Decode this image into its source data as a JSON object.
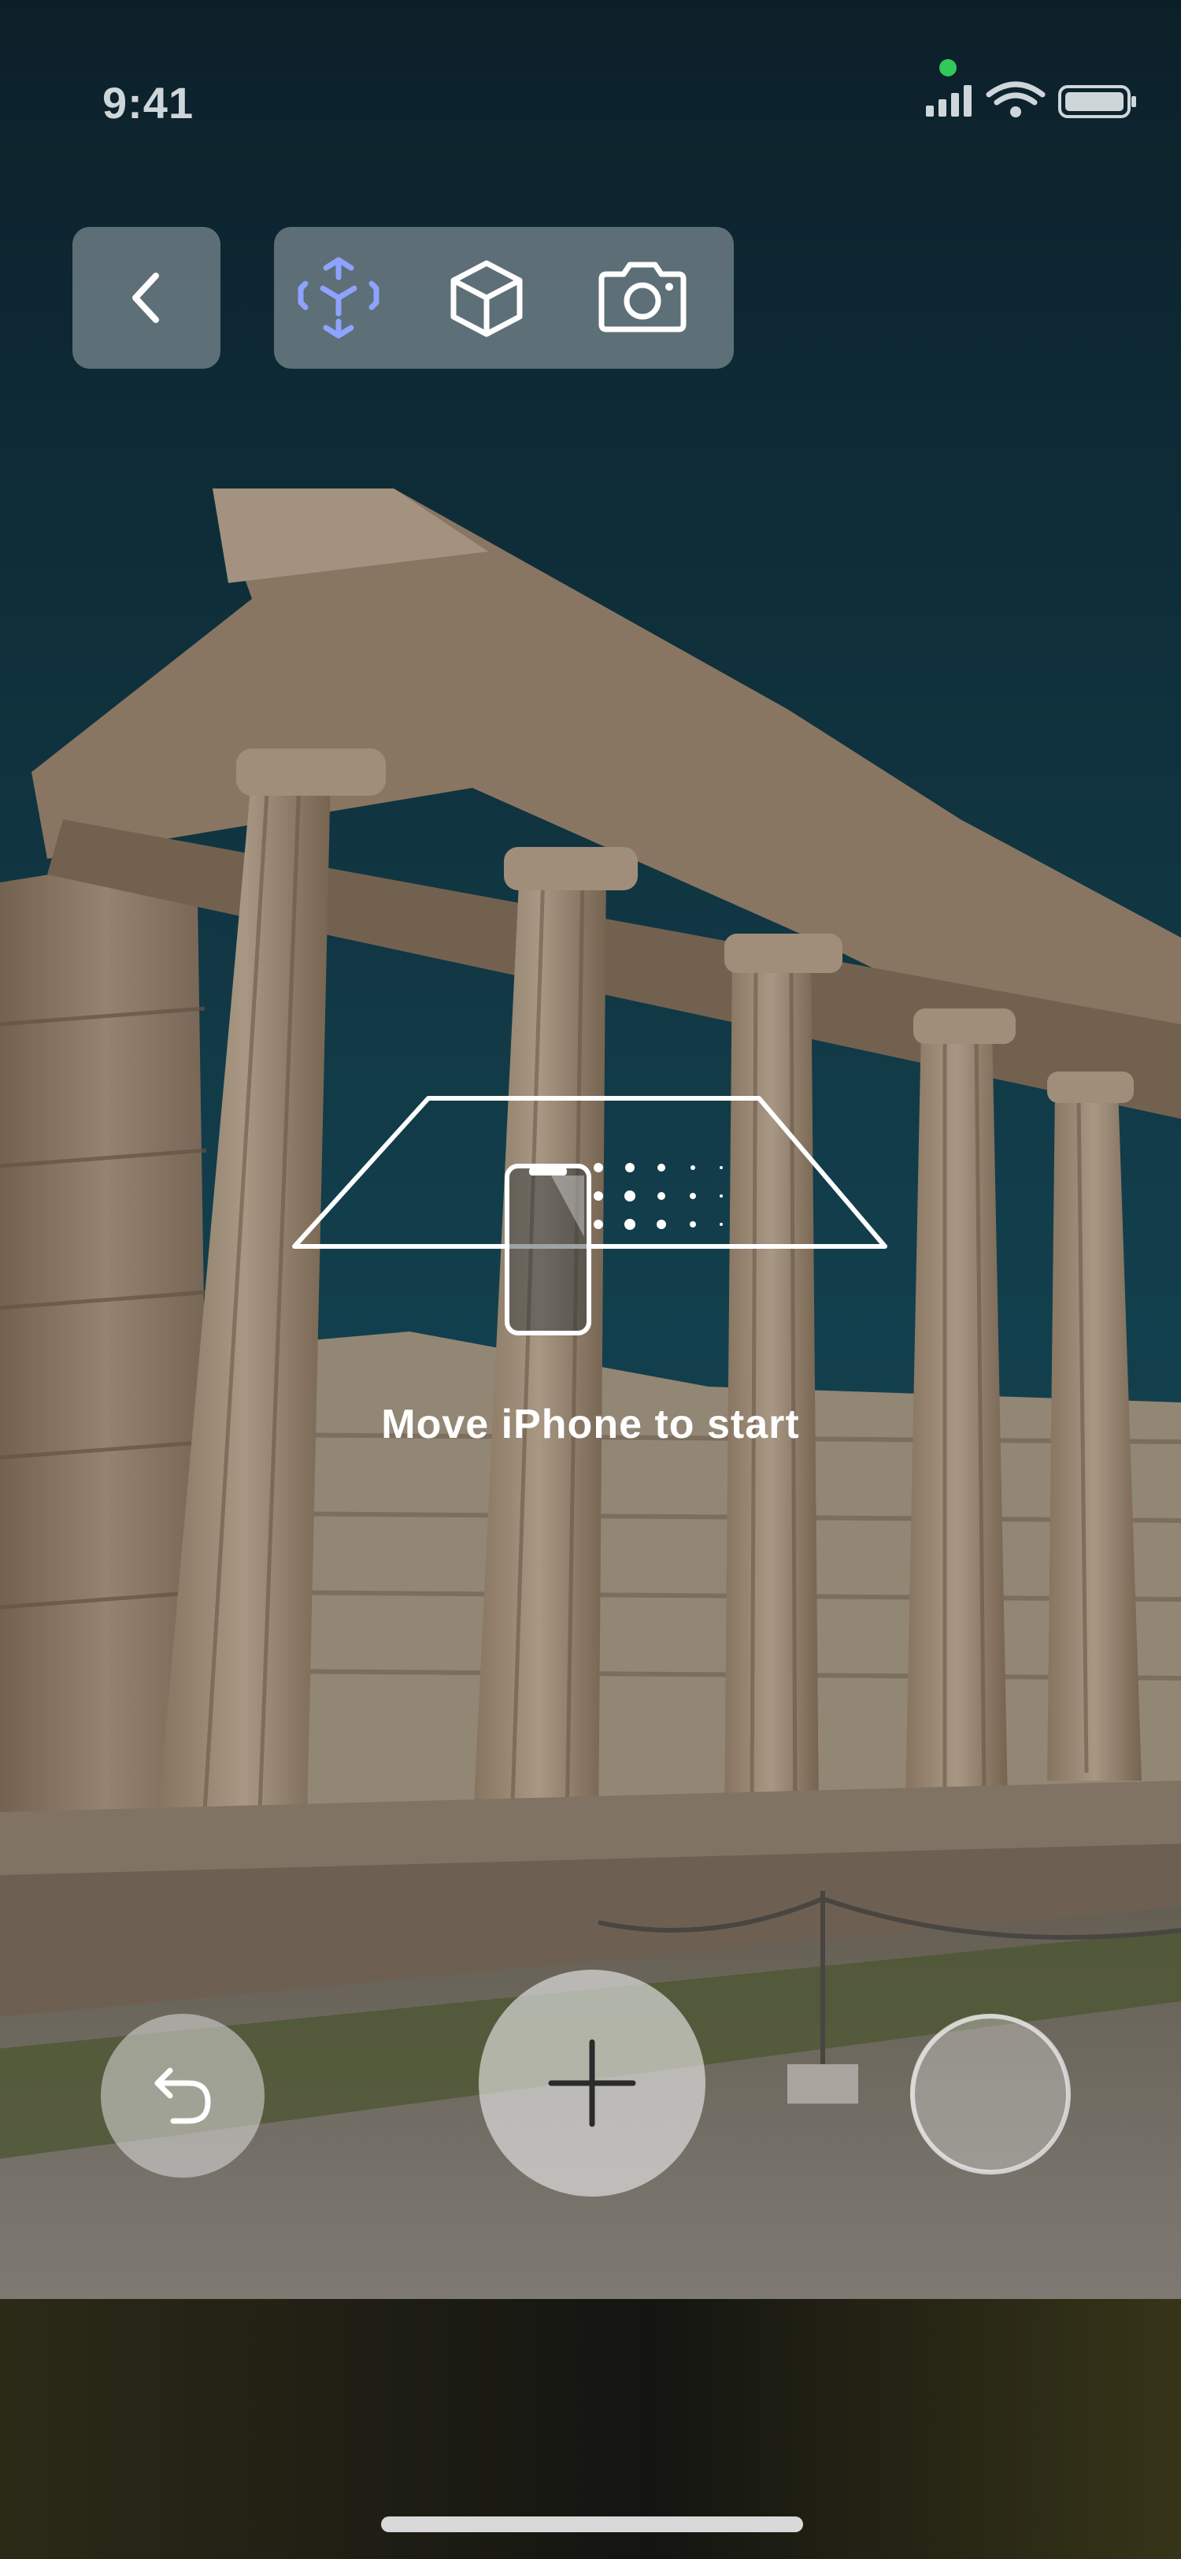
{
  "status_bar": {
    "time": "9:41"
  },
  "toolbar": {
    "back_icon": "chevron-left-icon",
    "modes": [
      {
        "name": "ar-measure",
        "icon": "ar-cube-scan-icon",
        "active": true
      },
      {
        "name": "3d-object",
        "icon": "cube-icon",
        "active": false
      },
      {
        "name": "photo",
        "icon": "camera-icon",
        "active": false
      }
    ]
  },
  "coaching": {
    "message": "Move iPhone to start"
  },
  "controls": {
    "undo_icon": "undo-icon",
    "add_icon": "plus-icon",
    "capture_icon": "shutter-icon"
  },
  "colors": {
    "active_mode": "#8ea3ff",
    "icon": "#ffffff"
  }
}
